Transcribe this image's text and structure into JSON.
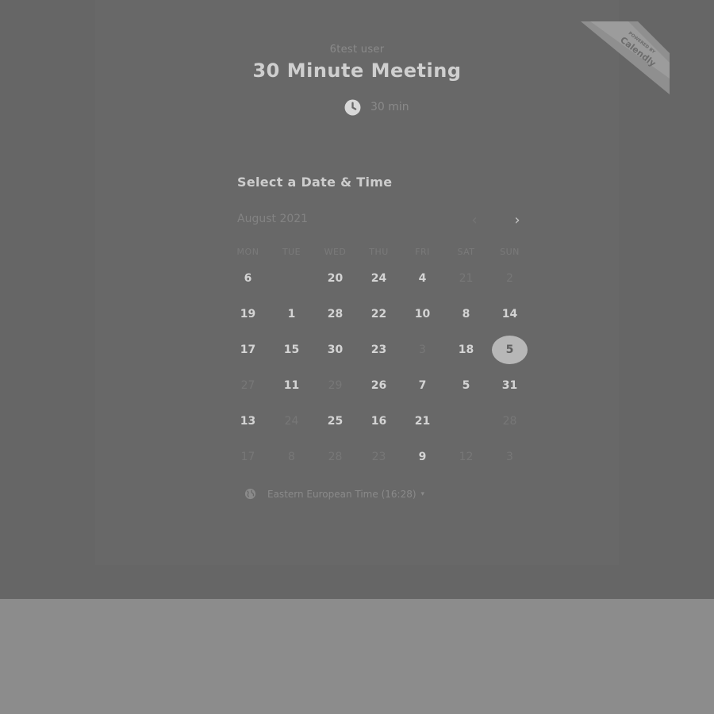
{
  "header": {
    "host": "6test user",
    "title": "30 Minute Meeting",
    "duration": "30 min",
    "badge_line1": "POWERED BY",
    "badge_line2": "Calendly"
  },
  "calendar": {
    "section_title": "Select a Date & Time",
    "month_label": "August 2021",
    "prev_icon": "‹",
    "next_icon": "›",
    "weekdays": [
      "MON",
      "TUE",
      "WED",
      "THU",
      "FRI",
      "SAT",
      "SUN"
    ],
    "days": [
      {
        "label": "6",
        "state": "available"
      },
      {
        "label": "",
        "state": "empty"
      },
      {
        "label": "20",
        "state": "available"
      },
      {
        "label": "24",
        "state": "available"
      },
      {
        "label": "4",
        "state": "available"
      },
      {
        "label": "21",
        "state": "unavailable"
      },
      {
        "label": "2",
        "state": "unavailable"
      },
      {
        "label": "19",
        "state": "available"
      },
      {
        "label": "1",
        "state": "available"
      },
      {
        "label": "28",
        "state": "available"
      },
      {
        "label": "22",
        "state": "available"
      },
      {
        "label": "10",
        "state": "available"
      },
      {
        "label": "8",
        "state": "available"
      },
      {
        "label": "14",
        "state": "available"
      },
      {
        "label": "17",
        "state": "available"
      },
      {
        "label": "15",
        "state": "available"
      },
      {
        "label": "30",
        "state": "available"
      },
      {
        "label": "23",
        "state": "available"
      },
      {
        "label": "3",
        "state": "unavailable"
      },
      {
        "label": "18",
        "state": "available"
      },
      {
        "label": "5",
        "state": "selected"
      },
      {
        "label": "27",
        "state": "unavailable"
      },
      {
        "label": "11",
        "state": "available"
      },
      {
        "label": "29",
        "state": "unavailable"
      },
      {
        "label": "26",
        "state": "available"
      },
      {
        "label": "7",
        "state": "available"
      },
      {
        "label": "5",
        "state": "available"
      },
      {
        "label": "31",
        "state": "available"
      },
      {
        "label": "13",
        "state": "available"
      },
      {
        "label": "24",
        "state": "unavailable"
      },
      {
        "label": "25",
        "state": "available"
      },
      {
        "label": "16",
        "state": "available"
      },
      {
        "label": "21",
        "state": "available"
      },
      {
        "label": "",
        "state": "empty"
      },
      {
        "label": "28",
        "state": "unavailable"
      },
      {
        "label": "17",
        "state": "unavailable"
      },
      {
        "label": "8",
        "state": "unavailable"
      },
      {
        "label": "28",
        "state": "unavailable"
      },
      {
        "label": "23",
        "state": "unavailable"
      },
      {
        "label": "9",
        "state": "available"
      },
      {
        "label": "12",
        "state": "unavailable"
      },
      {
        "label": "3",
        "state": "unavailable"
      }
    ]
  },
  "timezone": {
    "label": "Eastern European Time (16:28)",
    "caret": "▾"
  },
  "icons": {
    "duration": "clock-icon",
    "timezone": "globe-icon",
    "prev": "chevron-left-icon",
    "next": "chevron-right-icon"
  },
  "colors": {
    "overlay": "#666666",
    "page_below": "#8c8c8c",
    "selected_day": "#b7b7b7"
  }
}
